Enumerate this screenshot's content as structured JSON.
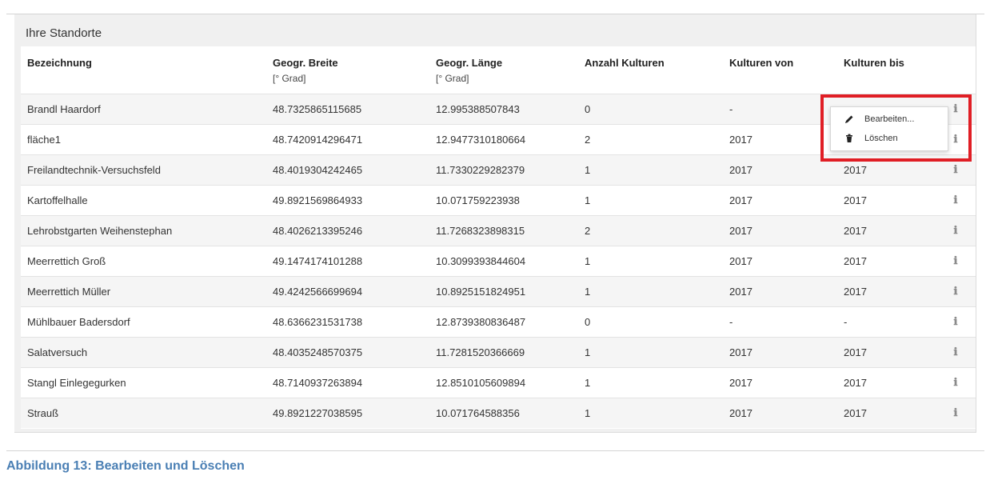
{
  "panel": {
    "title": "Ihre Standorte"
  },
  "table": {
    "headers": {
      "name": "Bezeichnung",
      "lat": "Geogr. Breite",
      "lat_unit": "[° Grad]",
      "lon": "Geogr. Länge",
      "lon_unit": "[° Grad]",
      "count": "Anzahl Kulturen",
      "from": "Kulturen von",
      "to": "Kulturen bis"
    },
    "rows": [
      {
        "name": "Brandl Haardorf",
        "lat": "48.7325865115685",
        "lon": "12.995388507843",
        "count": "0",
        "from": "-",
        "to": ""
      },
      {
        "name": "fläche1",
        "lat": "48.7420914296471",
        "lon": "12.9477310180664",
        "count": "2",
        "from": "2017",
        "to": ""
      },
      {
        "name": "Freilandtechnik-Versuchsfeld",
        "lat": "48.4019304242465",
        "lon": "11.7330229282379",
        "count": "1",
        "from": "2017",
        "to": "2017"
      },
      {
        "name": "Kartoffelhalle",
        "lat": "49.8921569864933",
        "lon": "10.071759223938",
        "count": "1",
        "from": "2017",
        "to": "2017"
      },
      {
        "name": "Lehrobstgarten Weihenstephan",
        "lat": "48.4026213395246",
        "lon": "11.7268323898315",
        "count": "2",
        "from": "2017",
        "to": "2017"
      },
      {
        "name": "Meerrettich Groß",
        "lat": "49.1474174101288",
        "lon": "10.3099393844604",
        "count": "1",
        "from": "2017",
        "to": "2017"
      },
      {
        "name": "Meerrettich Müller",
        "lat": "49.4242566699694",
        "lon": "10.8925151824951",
        "count": "1",
        "from": "2017",
        "to": "2017"
      },
      {
        "name": "Mühlbauer Badersdorf",
        "lat": "48.6366231531738",
        "lon": "12.8739380836487",
        "count": "0",
        "from": "-",
        "to": "-"
      },
      {
        "name": "Salatversuch",
        "lat": "48.4035248570375",
        "lon": "11.7281520366669",
        "count": "1",
        "from": "2017",
        "to": "2017"
      },
      {
        "name": "Stangl Einlegegurken",
        "lat": "48.7140937263894",
        "lon": "12.8510105609894",
        "count": "1",
        "from": "2017",
        "to": "2017"
      },
      {
        "name": "Strauß",
        "lat": "49.8921227038595",
        "lon": "10.071764588356",
        "count": "1",
        "from": "2017",
        "to": "2017"
      }
    ]
  },
  "context_menu": {
    "edit_label": "Bearbeiten...",
    "delete_label": "Löschen",
    "edit_icon": "pencil-icon",
    "delete_icon": "trash-icon"
  },
  "row_action_icon": "info-icon",
  "caption": "Abbildung 13: Bearbeiten und Löschen",
  "colors": {
    "highlight": "#e01e25",
    "caption": "#4a7fb4"
  }
}
